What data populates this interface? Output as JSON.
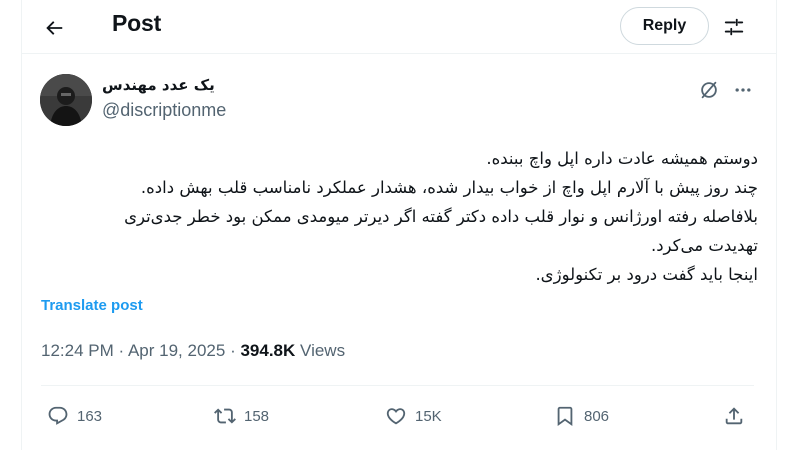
{
  "header": {
    "title": "Post",
    "reply_label": "Reply"
  },
  "author": {
    "display_name": "یک عدد مهندس",
    "handle": "@discriptionme"
  },
  "tweet": {
    "lines": [
      "دوستم همیشه عادت داره اپل واچ ببنده.",
      "چند روز پیش با آلارم اپل واچ از خواب بیدار شده، هشدار عملکرد نامناسب قلب بهش داده.",
      "بلافاصله رفته اورژانس و نوار قلب داده دکتر گفته اگر دیرتر میومدی ممکن بود خطر جدی‌تری",
      "تهدیدت می‌کرد.",
      "اینجا باید گفت درود بر تکنولوژی."
    ],
    "translate_label": "Translate post"
  },
  "meta": {
    "time": "12:24 PM",
    "separator": "·",
    "date": "Apr 19, 2025",
    "views_count": "394.8K",
    "views_label": "Views"
  },
  "actions": {
    "replies": "163",
    "reposts": "158",
    "likes": "15K",
    "bookmarks": "806"
  },
  "icons": {
    "back": "arrow-left-icon",
    "settings": "sliders-icon",
    "grok": "grok-icon",
    "more": "more-icon",
    "reply": "comment-icon",
    "repost": "repost-icon",
    "like": "heart-icon",
    "bookmark": "bookmark-icon",
    "share": "share-icon"
  },
  "colors": {
    "accent": "#1d9bf0",
    "secondary_text": "#536471",
    "primary_text": "#0f1419",
    "border": "#eff3f4"
  }
}
